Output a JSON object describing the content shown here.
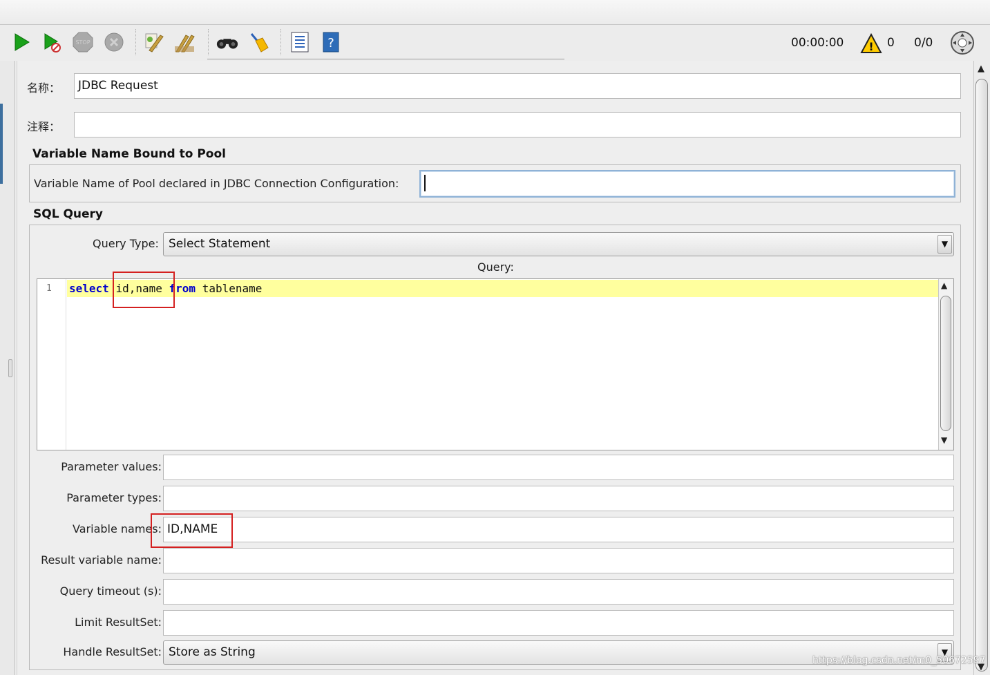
{
  "toolbar": {
    "timer": "00:00:00",
    "warning_count": "0",
    "thread_count": "0/0",
    "icons": [
      "start-icon",
      "start-no-pause-icon",
      "stop-icon",
      "shutdown-icon",
      "clear-icon",
      "clear-all-icon",
      "search-icon",
      "reset-search-icon",
      "function-helper-icon",
      "help-icon",
      "warning-icon",
      "remote-icon"
    ]
  },
  "form": {
    "name_label": "名称：",
    "name_value": "JDBC Request",
    "comment_label": "注释：",
    "comment_value": ""
  },
  "pool_section": {
    "title": "Variable Name Bound to Pool",
    "pool_label": "Variable Name of Pool declared in JDBC Connection Configuration:",
    "pool_value": ""
  },
  "sql_section": {
    "title": "SQL Query",
    "query_type_label": "Query Type:",
    "query_type_value": "Select Statement",
    "query_label": "Query:",
    "line_number": "1",
    "code": {
      "kw1": "select",
      "cols": "id,name",
      "kw2": "from",
      "table": "tablename"
    }
  },
  "params": {
    "param_values_label": "Parameter values:",
    "param_values_value": "",
    "param_types_label": "Parameter types:",
    "param_types_value": "",
    "var_names_label": "Variable names:",
    "var_names_value": "ID,NAME",
    "result_var_label": "Result variable name:",
    "result_var_value": "",
    "timeout_label": "Query timeout (s):",
    "timeout_value": "",
    "limit_label": "Limit ResultSet:",
    "limit_value": "",
    "handle_label": "Handle ResultSet:",
    "handle_value": "Store as String"
  },
  "watermark": "https://blog.csdn.net/m0_50672597"
}
